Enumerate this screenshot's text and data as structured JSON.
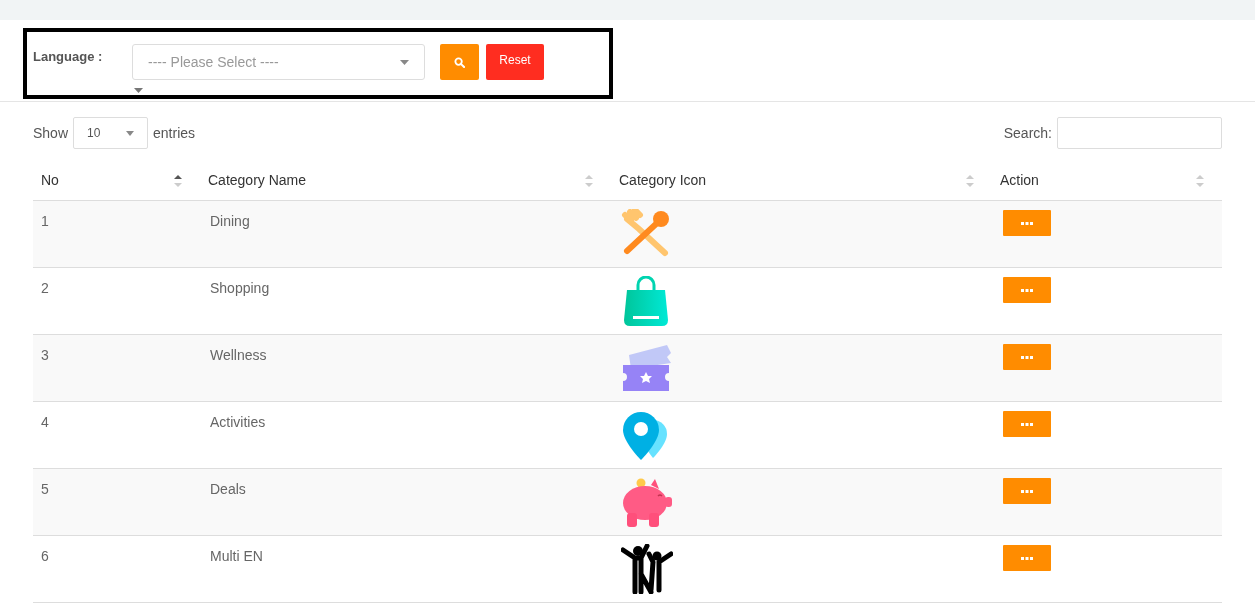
{
  "filter": {
    "label": "Language :",
    "select": {
      "placeholder": "---- Please Select ----"
    },
    "reset_button": "Reset"
  },
  "length": {
    "prefix": "Show",
    "value": "10",
    "suffix": "entries"
  },
  "search": {
    "label": "Search:"
  },
  "table": {
    "columns": [
      {
        "label": "No",
        "sorted": true
      },
      {
        "label": "Category Name",
        "sorted": false
      },
      {
        "label": "Category Icon",
        "sorted": false
      },
      {
        "label": "Action",
        "sorted": false
      }
    ],
    "rows": [
      {
        "no": "1",
        "name": "Dining",
        "kind": "dining"
      },
      {
        "no": "2",
        "name": "Shopping",
        "kind": "bag"
      },
      {
        "no": "3",
        "name": "Wellness",
        "kind": "ticket"
      },
      {
        "no": "4",
        "name": "Activities",
        "kind": "pin"
      },
      {
        "no": "5",
        "name": "Deals",
        "kind": "piggy"
      },
      {
        "no": "6",
        "name": "Multi EN",
        "kind": "people"
      }
    ]
  }
}
